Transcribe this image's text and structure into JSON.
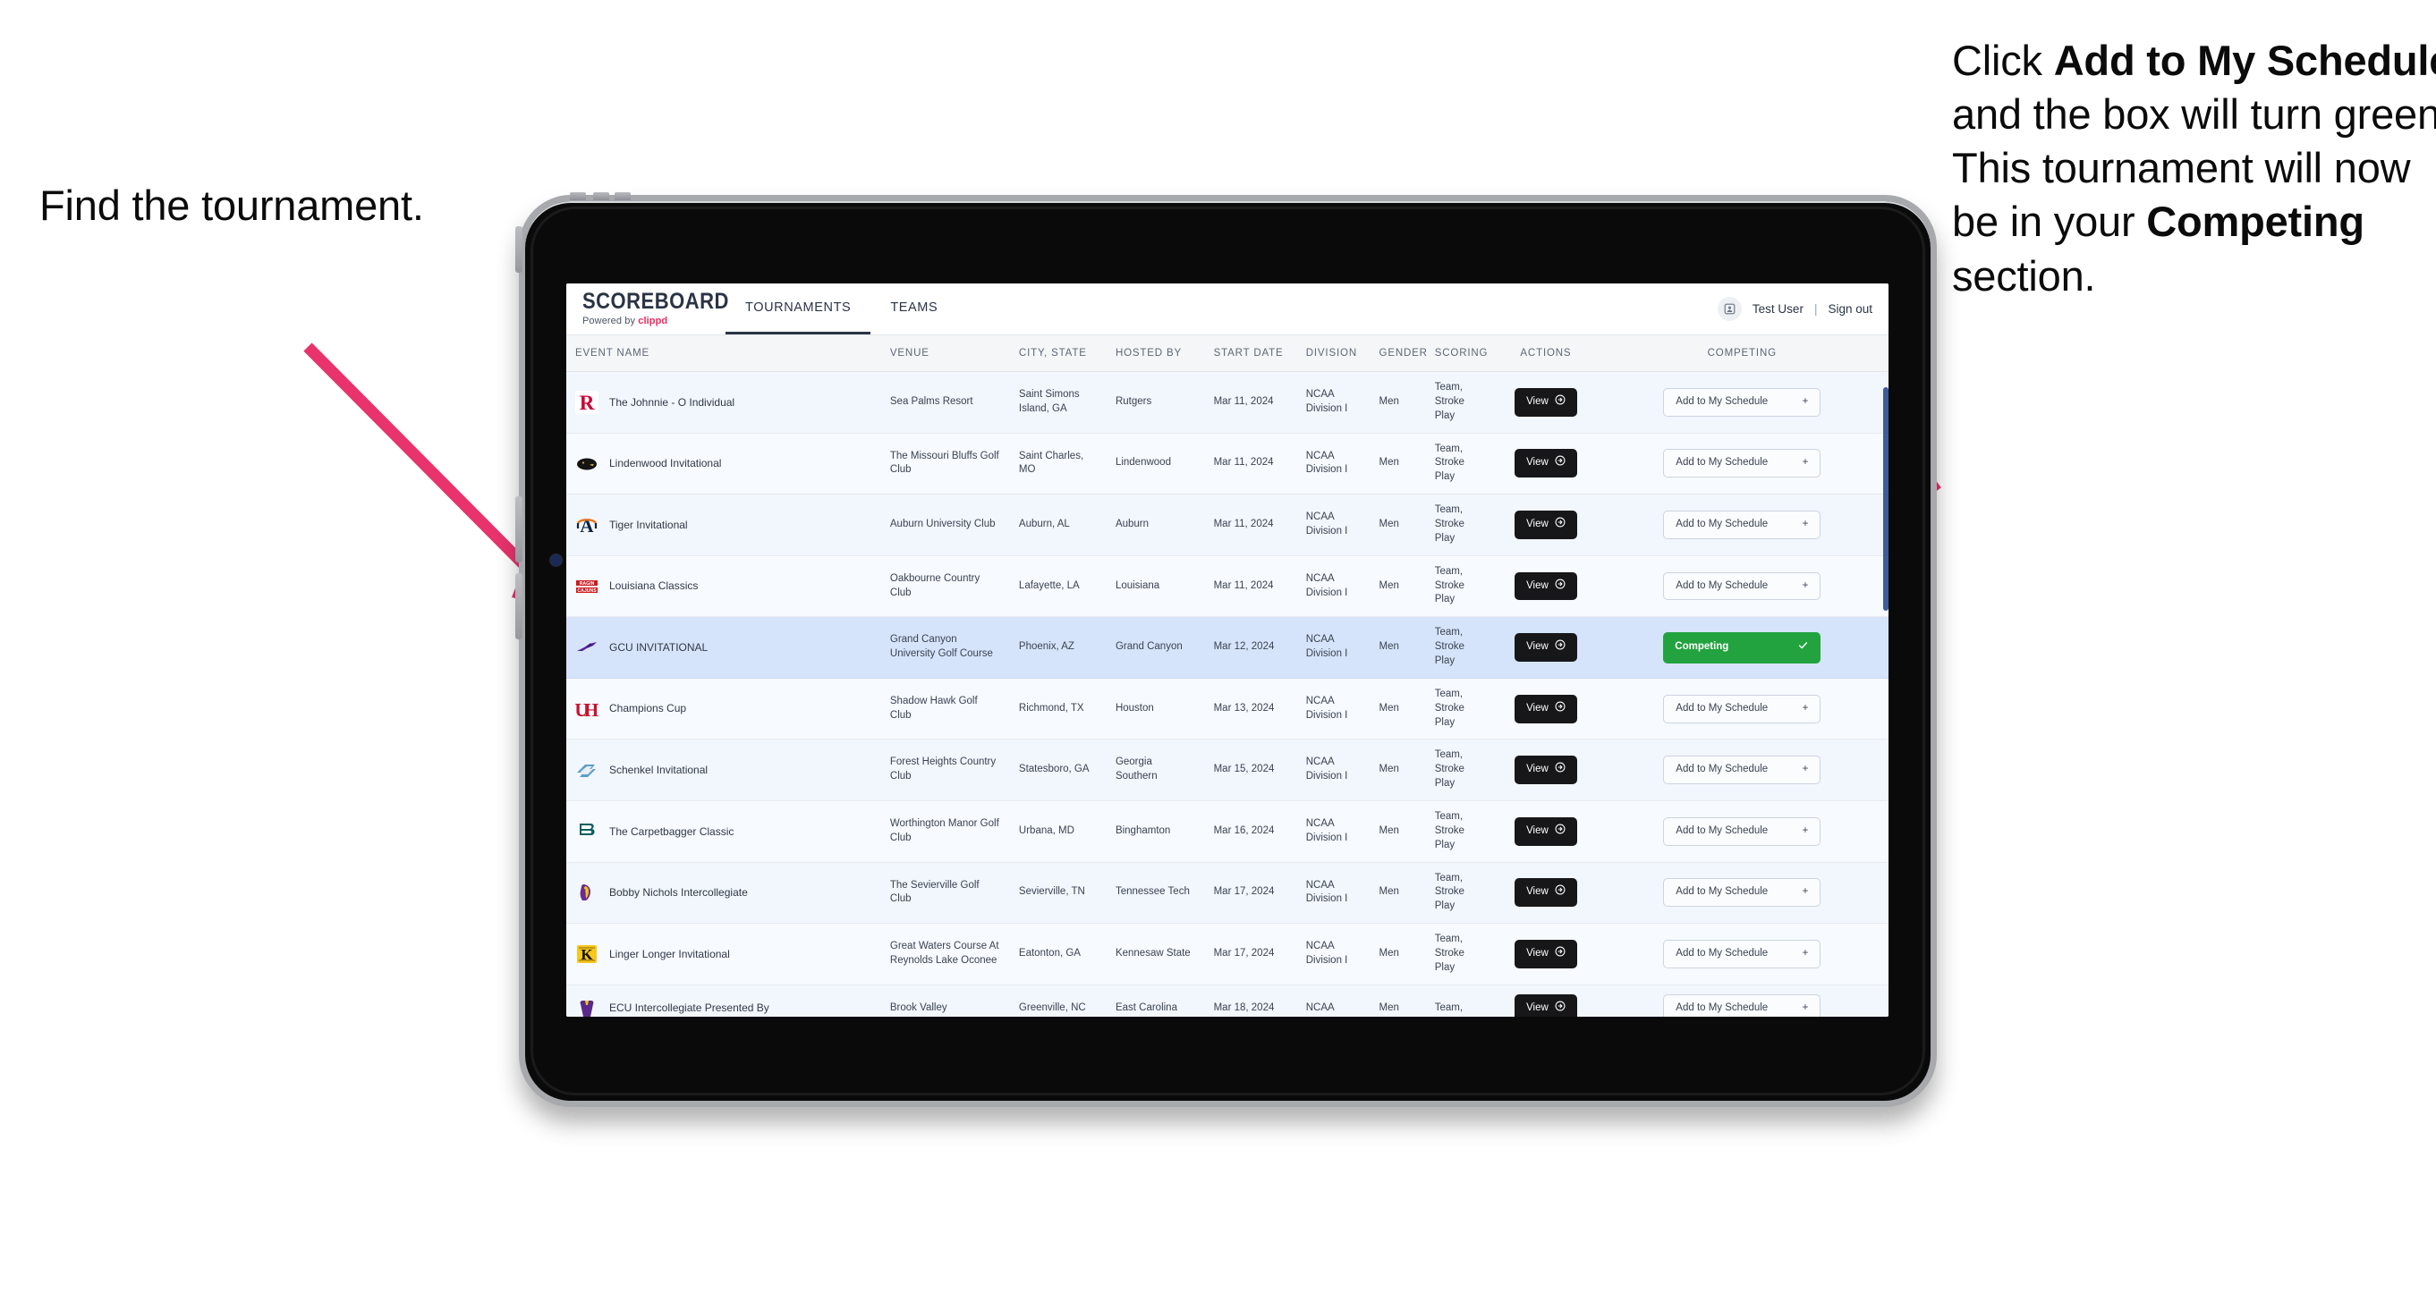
{
  "annotations": {
    "left": "Find the tournament.",
    "right_parts": [
      {
        "t": "Click ",
        "b": false
      },
      {
        "t": "Add to My Schedule",
        "b": true
      },
      {
        "t": " and the box will turn green. This tournament will now be in your ",
        "b": false
      },
      {
        "t": "Competing",
        "b": true
      },
      {
        "t": " section.",
        "b": false
      }
    ],
    "arrow_color": "#e8336d"
  },
  "app": {
    "brand": {
      "name": "SCOREBOARD",
      "powered_prefix": "Powered by ",
      "powered_name": "clippd"
    },
    "nav": [
      {
        "label": "TOURNAMENTS",
        "active": true
      },
      {
        "label": "TEAMS",
        "active": false
      }
    ],
    "header_right": {
      "avatar_icon": "user-avatar-icon",
      "user": "Test User",
      "separator": "|",
      "signout": "Sign out"
    },
    "colors": {
      "accent_green": "#22a33f",
      "dark": "#17171a",
      "brand_pink": "#ee2a5e",
      "selected_row": "#d6e4fb"
    }
  },
  "table": {
    "columns": [
      "EVENT NAME",
      "VENUE",
      "CITY, STATE",
      "HOSTED BY",
      "START DATE",
      "DIVISION",
      "GENDER",
      "SCORING",
      "ACTIONS",
      "COMPETING"
    ],
    "action_label": "View",
    "add_label": "Add to My Schedule",
    "add_plus": "+",
    "competing_label": "Competing",
    "competing_check": "✓",
    "rows": [
      {
        "logo": "rutgers-logo",
        "event": "The Johnnie - O Individual",
        "venue": "Sea Palms Resort",
        "city": "Saint Simons Island, GA",
        "host": "Rutgers",
        "date": "Mar 11, 2024",
        "division": "NCAA Division I",
        "gender": "Men",
        "scoring": "Team, Stroke Play",
        "competing": false
      },
      {
        "logo": "lindenwood-logo",
        "event": "Lindenwood Invitational",
        "venue": "The Missouri Bluffs Golf Club",
        "city": "Saint Charles, MO",
        "host": "Lindenwood",
        "date": "Mar 11, 2024",
        "division": "NCAA Division I",
        "gender": "Men",
        "scoring": "Team, Stroke Play",
        "competing": false
      },
      {
        "logo": "auburn-logo",
        "event": "Tiger Invitational",
        "venue": "Auburn University Club",
        "city": "Auburn, AL",
        "host": "Auburn",
        "date": "Mar 11, 2024",
        "division": "NCAA Division I",
        "gender": "Men",
        "scoring": "Team, Stroke Play",
        "competing": false
      },
      {
        "logo": "louisiana-logo",
        "event": "Louisiana Classics",
        "venue": "Oakbourne Country Club",
        "city": "Lafayette, LA",
        "host": "Louisiana",
        "date": "Mar 11, 2024",
        "division": "NCAA Division I",
        "gender": "Men",
        "scoring": "Team, Stroke Play",
        "competing": false
      },
      {
        "logo": "gcu-logo",
        "event": "GCU INVITATIONAL",
        "venue": "Grand Canyon University Golf Course",
        "city": "Phoenix, AZ",
        "host": "Grand Canyon",
        "date": "Mar 12, 2024",
        "division": "NCAA Division I",
        "gender": "Men",
        "scoring": "Team, Stroke Play",
        "competing": true
      },
      {
        "logo": "houston-logo",
        "event": "Champions Cup",
        "venue": "Shadow Hawk Golf Club",
        "city": "Richmond, TX",
        "host": "Houston",
        "date": "Mar 13, 2024",
        "division": "NCAA Division I",
        "gender": "Men",
        "scoring": "Team, Stroke Play",
        "competing": false
      },
      {
        "logo": "georgia-southern-logo",
        "event": "Schenkel Invitational",
        "venue": "Forest Heights Country Club",
        "city": "Statesboro, GA",
        "host": "Georgia Southern",
        "date": "Mar 15, 2024",
        "division": "NCAA Division I",
        "gender": "Men",
        "scoring": "Team, Stroke Play",
        "competing": false
      },
      {
        "logo": "binghamton-logo",
        "event": "The Carpetbagger Classic",
        "venue": "Worthington Manor Golf Club",
        "city": "Urbana, MD",
        "host": "Binghamton",
        "date": "Mar 16, 2024",
        "division": "NCAA Division I",
        "gender": "Men",
        "scoring": "Team, Stroke Play",
        "competing": false
      },
      {
        "logo": "tennessee-tech-logo",
        "event": "Bobby Nichols Intercollegiate",
        "venue": "The Sevierville Golf Club",
        "city": "Sevierville, TN",
        "host": "Tennessee Tech",
        "date": "Mar 17, 2024",
        "division": "NCAA Division I",
        "gender": "Men",
        "scoring": "Team, Stroke Play",
        "competing": false
      },
      {
        "logo": "kennesaw-state-logo",
        "event": "Linger Longer Invitational",
        "venue": "Great Waters Course At Reynolds Lake Oconee",
        "city": "Eatonton, GA",
        "host": "Kennesaw State",
        "date": "Mar 17, 2024",
        "division": "NCAA Division I",
        "gender": "Men",
        "scoring": "Team, Stroke Play",
        "competing": false
      },
      {
        "logo": "ecu-logo",
        "event": "ECU Intercollegiate Presented By",
        "venue": "Brook Valley",
        "city": "Greenville, NC",
        "host": "East Carolina",
        "date": "Mar 18, 2024",
        "division": "NCAA",
        "gender": "Men",
        "scoring": "Team,",
        "competing": false
      }
    ]
  }
}
